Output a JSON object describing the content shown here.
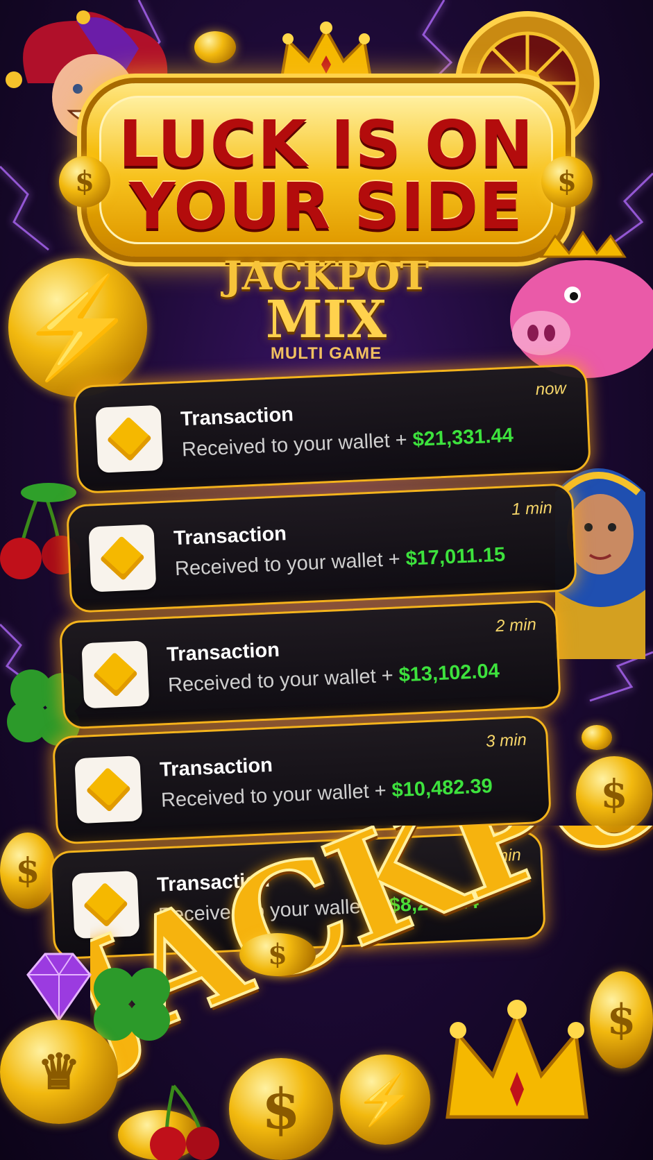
{
  "banner": {
    "line1": "LUCK IS ON",
    "line2": "YOUR SIDE"
  },
  "logo": {
    "line1": "JACKPOT",
    "line2": "MIX",
    "line3": "MULTI GAME"
  },
  "notifications": [
    {
      "title": "Transaction",
      "message": "Received to your wallet + ",
      "amount": "$21,331.44",
      "time": "now"
    },
    {
      "title": "Transaction",
      "message": "Received to your wallet + ",
      "amount": "$17,011.15",
      "time": "1 min"
    },
    {
      "title": "Transaction",
      "message": "Received to your wallet + ",
      "amount": "$13,102.04",
      "time": "2 min"
    },
    {
      "title": "Transaction",
      "message": "Received to your wallet + ",
      "amount": "$10,482.39",
      "time": "3 min"
    },
    {
      "title": "Transaction",
      "message": "Received to your wallet + ",
      "amount": "$8,250.24",
      "time": "5 min"
    }
  ],
  "jackpot_word": "JACKPOT",
  "colors": {
    "gold": "#f5b800",
    "banner_text": "#b30c0c",
    "amount_green": "#3de23d",
    "card_border": "#f4b41c",
    "background": "#1d0a36"
  }
}
